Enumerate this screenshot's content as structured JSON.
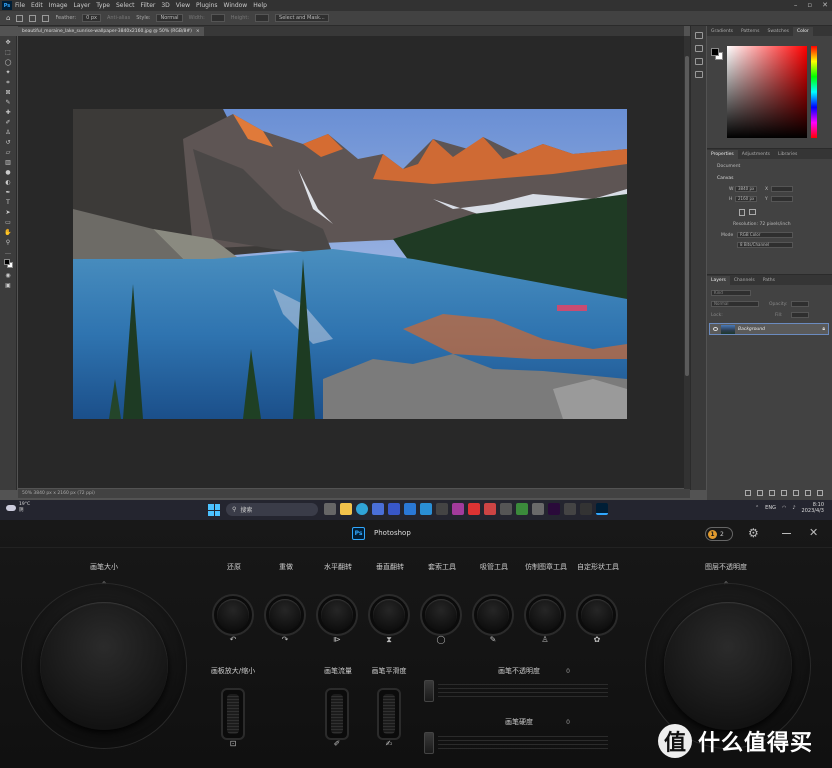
{
  "menubar": {
    "logo": "Ps",
    "items": [
      "File",
      "Edit",
      "Image",
      "Layer",
      "Type",
      "Select",
      "Filter",
      "3D",
      "View",
      "Plugins",
      "Window",
      "Help"
    ]
  },
  "options": {
    "feather_label": "Feather:",
    "feather_value": "0 px",
    "antialias": "Anti-alias",
    "style_label": "Style:",
    "style_value": "Normal",
    "width_label": "Width:",
    "height_label": "Height:",
    "select_mask": "Select and Mask..."
  },
  "document": {
    "tab_title": "beautiful_moraine_lake_sunrise-wallpaper-3840x2160.jpg @ 50% (RGB/8#)",
    "status": "50%   3840 px x 2160 px (72 ppi)"
  },
  "color_panel": {
    "tabs": [
      "Gradients",
      "Patterns",
      "Swatches",
      "Color"
    ],
    "foreground": "#000000",
    "background": "#ffffff"
  },
  "properties": {
    "tabs": [
      "Properties",
      "Adjustments",
      "Libraries"
    ],
    "type": "Document",
    "section": "Canvas",
    "w_label": "W",
    "w_value": "3840 px",
    "x_label": "X",
    "h_label": "H",
    "h_value": "2160 px",
    "y_label": "Y",
    "resolution": "Resolution: 72 pixels/inch",
    "mode_label": "Mode",
    "mode_value": "RGB Color",
    "depth_value": "8 Bits/Channel"
  },
  "layers": {
    "tabs": [
      "Layers",
      "Channels",
      "Paths"
    ],
    "kind": "Kind",
    "blend": "Normal",
    "opacity": "Opacity:",
    "fill": "Fill:",
    "lock": "Lock:",
    "layer_name": "Background"
  },
  "taskbar": {
    "weather_temp": "19°C",
    "weather_desc": "阴",
    "search": "搜索",
    "lang": "ENG",
    "time": "8:10",
    "date": "2023/4/3"
  },
  "creative": {
    "app_name": "Photoshop",
    "ps_logo": "Ps",
    "badge_count": "2",
    "left_dial_label": "画笔大小",
    "left_dial_value": "0",
    "right_dial_label": "图层不透明度",
    "right_dial_value": "0",
    "small_dials": [
      {
        "label": "还原",
        "icon": "↶"
      },
      {
        "label": "重做",
        "icon": "↷"
      },
      {
        "label": "水平翻转",
        "icon": "⧐"
      },
      {
        "label": "垂直翻转",
        "icon": "⧗"
      },
      {
        "label": "套索工具",
        "icon": "◯"
      },
      {
        "label": "吸管工具",
        "icon": "✎"
      },
      {
        "label": "仿制图章工具",
        "icon": "♙"
      },
      {
        "label": "自定形状工具",
        "icon": "✿"
      }
    ],
    "wheels": [
      {
        "label": "画板放大/缩小",
        "icon": "⊡"
      },
      {
        "label": "画笔流量",
        "icon": "✐"
      },
      {
        "label": "画笔平滑度",
        "icon": "✍"
      }
    ],
    "sliders": [
      {
        "label": "画笔不透明度",
        "value": "0"
      },
      {
        "label": "画笔硬度",
        "value": "0"
      }
    ]
  },
  "watermark": {
    "icon": "值",
    "text": "什么值得买"
  }
}
